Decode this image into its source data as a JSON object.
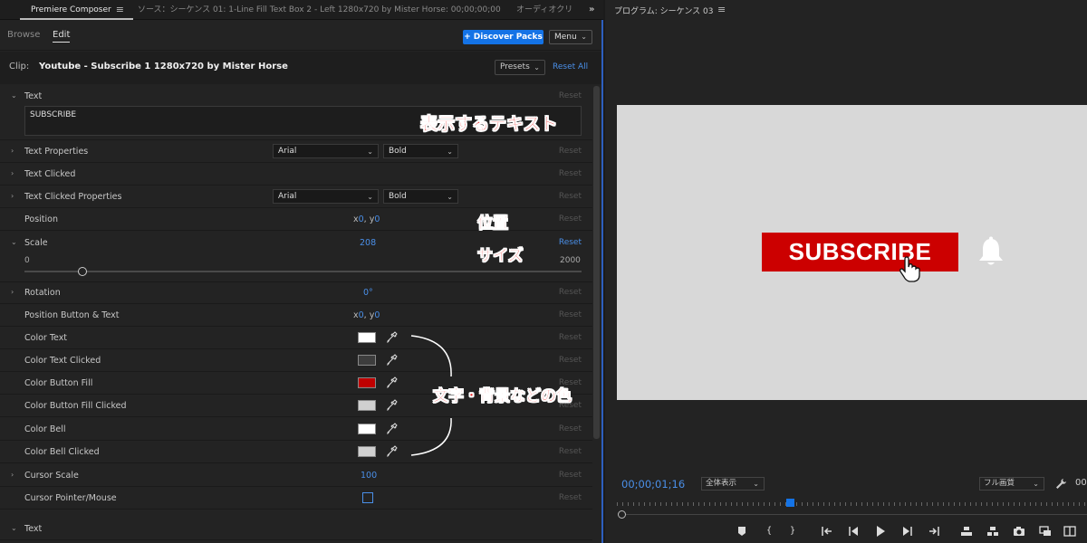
{
  "tabs": {
    "composer": "Premiere Composer",
    "source": "ソース：シーケンス 01: 1-Line Fill Text Box 2 - Left 1280x720 by Mister Horse: 00;00;00;00",
    "audio": "オーディオクリ",
    "more": "»"
  },
  "subtabs": {
    "browse": "Browse",
    "edit": "Edit"
  },
  "toolbar": {
    "discover_label": "+ Discover Packs",
    "menu_label": "Menu"
  },
  "clip": {
    "prefix": "Clip:",
    "name": "Youtube - Subscribe 1 1280x720 by Mister Horse",
    "presets_label": "Presets",
    "reset_all": "Reset All"
  },
  "reset_label": "Reset",
  "properties": {
    "text": {
      "label": "Text",
      "value": "SUBSCRIBE"
    },
    "text_properties": {
      "label": "Text Properties",
      "font": "Arial",
      "weight": "Bold"
    },
    "text_clicked": {
      "label": "Text Clicked"
    },
    "text_clicked_properties": {
      "label": "Text Clicked Properties",
      "font": "Arial",
      "weight": "Bold"
    },
    "position": {
      "label": "Position",
      "x_prefix": "x",
      "x": "0",
      "sep": ",",
      "y_prefix": "y",
      "y": "0"
    },
    "scale": {
      "label": "Scale",
      "value": "208",
      "min": "0",
      "max": "2000",
      "slider_fraction": 0.104
    },
    "rotation": {
      "label": "Rotation",
      "value": "0°"
    },
    "position_button_text": {
      "label": "Position Button & Text",
      "x_prefix": "x",
      "x": "0",
      "sep": ",",
      "y_prefix": "y",
      "y": "0"
    },
    "color_text": {
      "label": "Color Text",
      "color": "#ffffff"
    },
    "color_text_clicked": {
      "label": "Color Text Clicked",
      "color": "#3d3d3d"
    },
    "color_button_fill": {
      "label": "Color Button Fill",
      "color": "#c00000"
    },
    "color_button_fill_clicked": {
      "label": "Color Button Fill Clicked",
      "color": "#d0d0d0"
    },
    "color_bell": {
      "label": "Color Bell",
      "color": "#ffffff"
    },
    "color_bell_clicked": {
      "label": "Color Bell Clicked",
      "color": "#d0d0d0"
    },
    "cursor_scale": {
      "label": "Cursor Scale",
      "value": "100"
    },
    "cursor_pointer": {
      "label": "Cursor Pointer/Mouse",
      "checked": false
    },
    "text2": {
      "label": "Text"
    }
  },
  "annotations": {
    "text_note": "表示するテキスト",
    "position_note": "位置",
    "size_note": "サイズ",
    "color_note": "文字・背景などの色"
  },
  "program": {
    "title": "プログラム: シーケンス 03",
    "preview_button_text": "SUBSCRIBE",
    "timecode": "00;00;01;16",
    "zoom": "全体表示",
    "quality": "フル画質",
    "trailing": "00"
  },
  "colors": {
    "accent": "#1473e6",
    "link": "#4a8fe8",
    "button_red": "#cc0000",
    "annotation_red": "#e82020"
  }
}
